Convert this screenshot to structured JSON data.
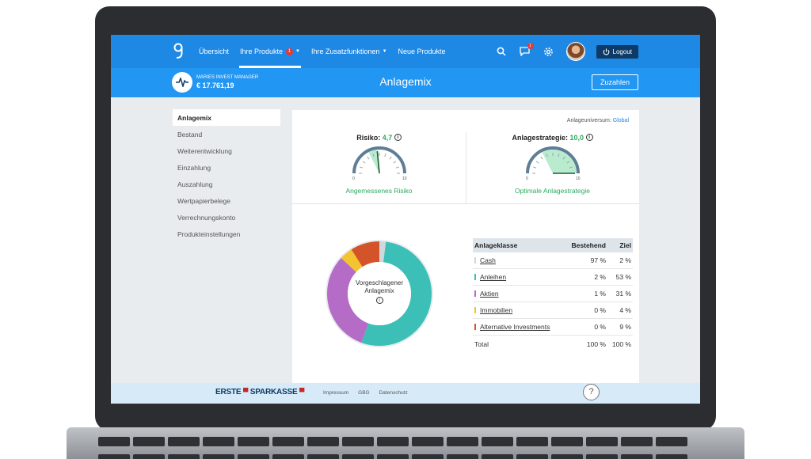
{
  "nav": {
    "items": [
      {
        "label": "Übersicht"
      },
      {
        "label": "Ihre Produkte",
        "badge": "1"
      },
      {
        "label": "Ihre Zusatzfunktionen"
      },
      {
        "label": "Neue Produkte"
      }
    ],
    "message_badge": "1",
    "logout_label": "Logout"
  },
  "account": {
    "name": "MARIES INVEST MANAGER",
    "value": "€ 17.761,19"
  },
  "page_title": "Anlagemix",
  "zuzahlen_label": "Zuzahlen",
  "sidebar": {
    "items": [
      {
        "label": "Anlagemix"
      },
      {
        "label": "Bestand"
      },
      {
        "label": "Weiterentwicklung"
      },
      {
        "label": "Einzahlung"
      },
      {
        "label": "Auszahlung"
      },
      {
        "label": "Wertpapierbelege"
      },
      {
        "label": "Verrechnungskonto"
      },
      {
        "label": "Produkteinstellungen"
      }
    ]
  },
  "universe": {
    "label": "Anlageuniversum:",
    "value": "Global"
  },
  "risk": {
    "label": "Risiko:",
    "value": "4,7",
    "level": 4.7,
    "scale_min": "0",
    "scale_max": "10",
    "subtitle": "Angemessenes Risiko"
  },
  "strategy": {
    "label": "Anlagestrategie:",
    "value": "10,0",
    "level": 10.0,
    "scale_min": "0",
    "scale_max": "10",
    "subtitle": "Optimale Anlagestrategie"
  },
  "donut": {
    "label_line1": "Vorgeschlagener",
    "label_line2": "Anlagemix",
    "segments": [
      {
        "name": "Cash",
        "value": 2,
        "color": "#cfd8dc"
      },
      {
        "name": "Anleihen",
        "value": 53,
        "color": "#3bbfb6"
      },
      {
        "name": "Aktien",
        "value": 31,
        "color": "#b46cc7"
      },
      {
        "name": "Immobilien",
        "value": 4,
        "color": "#f4c430"
      },
      {
        "name": "Alternative Investments",
        "value": 9,
        "color": "#d4542a"
      }
    ]
  },
  "table": {
    "headers": {
      "name": "Anlageklasse",
      "current": "Bestehend",
      "target": "Ziel"
    },
    "rows": [
      {
        "name": "Cash",
        "current": "97 %",
        "target": "2 %",
        "color": "#cfd8dc"
      },
      {
        "name": "Anleihen",
        "current": "2 %",
        "target": "53 %",
        "color": "#3bbfb6"
      },
      {
        "name": "Aktien",
        "current": "1 %",
        "target": "31 %",
        "color": "#b46cc7"
      },
      {
        "name": "Immobilien",
        "current": "0 %",
        "target": "4 %",
        "color": "#f4c430"
      },
      {
        "name": "Alternative Investments",
        "current": "0 %",
        "target": "9 %",
        "color": "#d4542a"
      }
    ],
    "total": {
      "name": "Total",
      "current": "100 %",
      "target": "100 %"
    }
  },
  "footer": {
    "brand_1": "ERSTE",
    "brand_2": "SPARKASSE",
    "links": [
      "Impressum",
      "GBG",
      "Datenschutz"
    ],
    "help": "?"
  }
}
